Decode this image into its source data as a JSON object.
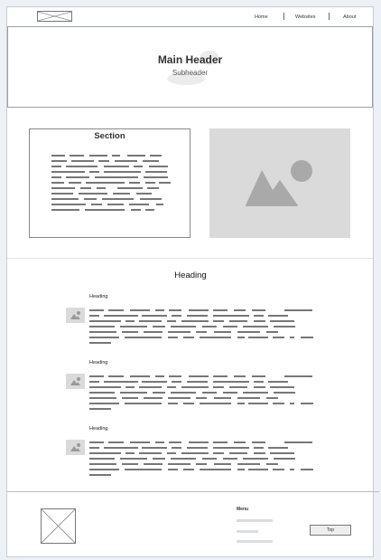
{
  "nav": {
    "items": [
      "Home",
      "Websites",
      "About"
    ]
  },
  "hero": {
    "title": "Main Header",
    "subtitle": "Subheader"
  },
  "section": {
    "title": "Section"
  },
  "content": {
    "heading": "Heading",
    "items": [
      {
        "heading": "Heading"
      },
      {
        "heading": "Heading"
      },
      {
        "heading": "Heading"
      }
    ]
  },
  "footer": {
    "menu_title": "Menu",
    "top_button": "Top"
  },
  "icons": {
    "logo": "placeholder-image-icon",
    "image": "image-icon"
  }
}
